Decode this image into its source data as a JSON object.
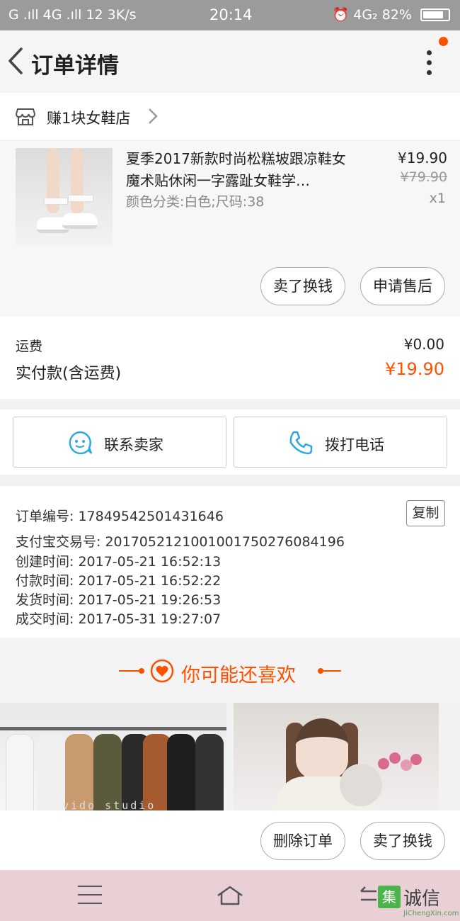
{
  "status_bar": {
    "left": "G .ıll 4G .ıll 12  3K/s",
    "time": "20:14",
    "network": "4G₂",
    "battery": "82%"
  },
  "header": {
    "title": "订单详情"
  },
  "shop": {
    "name": "赚1块女鞋店"
  },
  "goods": {
    "title": "夏季2017新款时尚松糕坡跟凉鞋女魔术贴休闲一字露趾女鞋学…",
    "sku": "颜色分类:白色;尺码:38",
    "price": "¥19.90",
    "original_price": "¥79.90",
    "quantity": "x1",
    "actions": [
      "卖了换钱",
      "申请售后"
    ]
  },
  "fees": {
    "shipping_label": "运费",
    "shipping_value": "¥0.00",
    "paid_label": "实付款(含运费)",
    "paid_value": "¥19.90"
  },
  "contact": {
    "seller_label": "联系卖家",
    "call_label": "拨打电话"
  },
  "order_info": {
    "order_no": "订单编号: 17849542501431646",
    "copy_label": "复制",
    "alipay_no": "支付宝交易号: 2017052121001001750276084196",
    "created": "创建时间: 2017-05-21  16:52:13",
    "paid": "付款时间: 2017-05-21  16:52:22",
    "shipped": "发货时间: 2017-05-21  19:26:53",
    "completed": "成交时间: 2017-05-31  19:27:07"
  },
  "recommend": {
    "heading": "你可能还喜欢",
    "watermark": "vido studio"
  },
  "bottom_actions": {
    "delete_label": "删除订单",
    "sell_label": "卖了换钱"
  },
  "logo": {
    "mark": "集",
    "name": "诚信",
    "sub": "JiChengXin.com"
  },
  "colors": {
    "accent": "#ff5000",
    "status_bar": "#9b9b9b",
    "nav_bar": "#e8d0d5",
    "contact_icon": "#2fa8e0"
  }
}
